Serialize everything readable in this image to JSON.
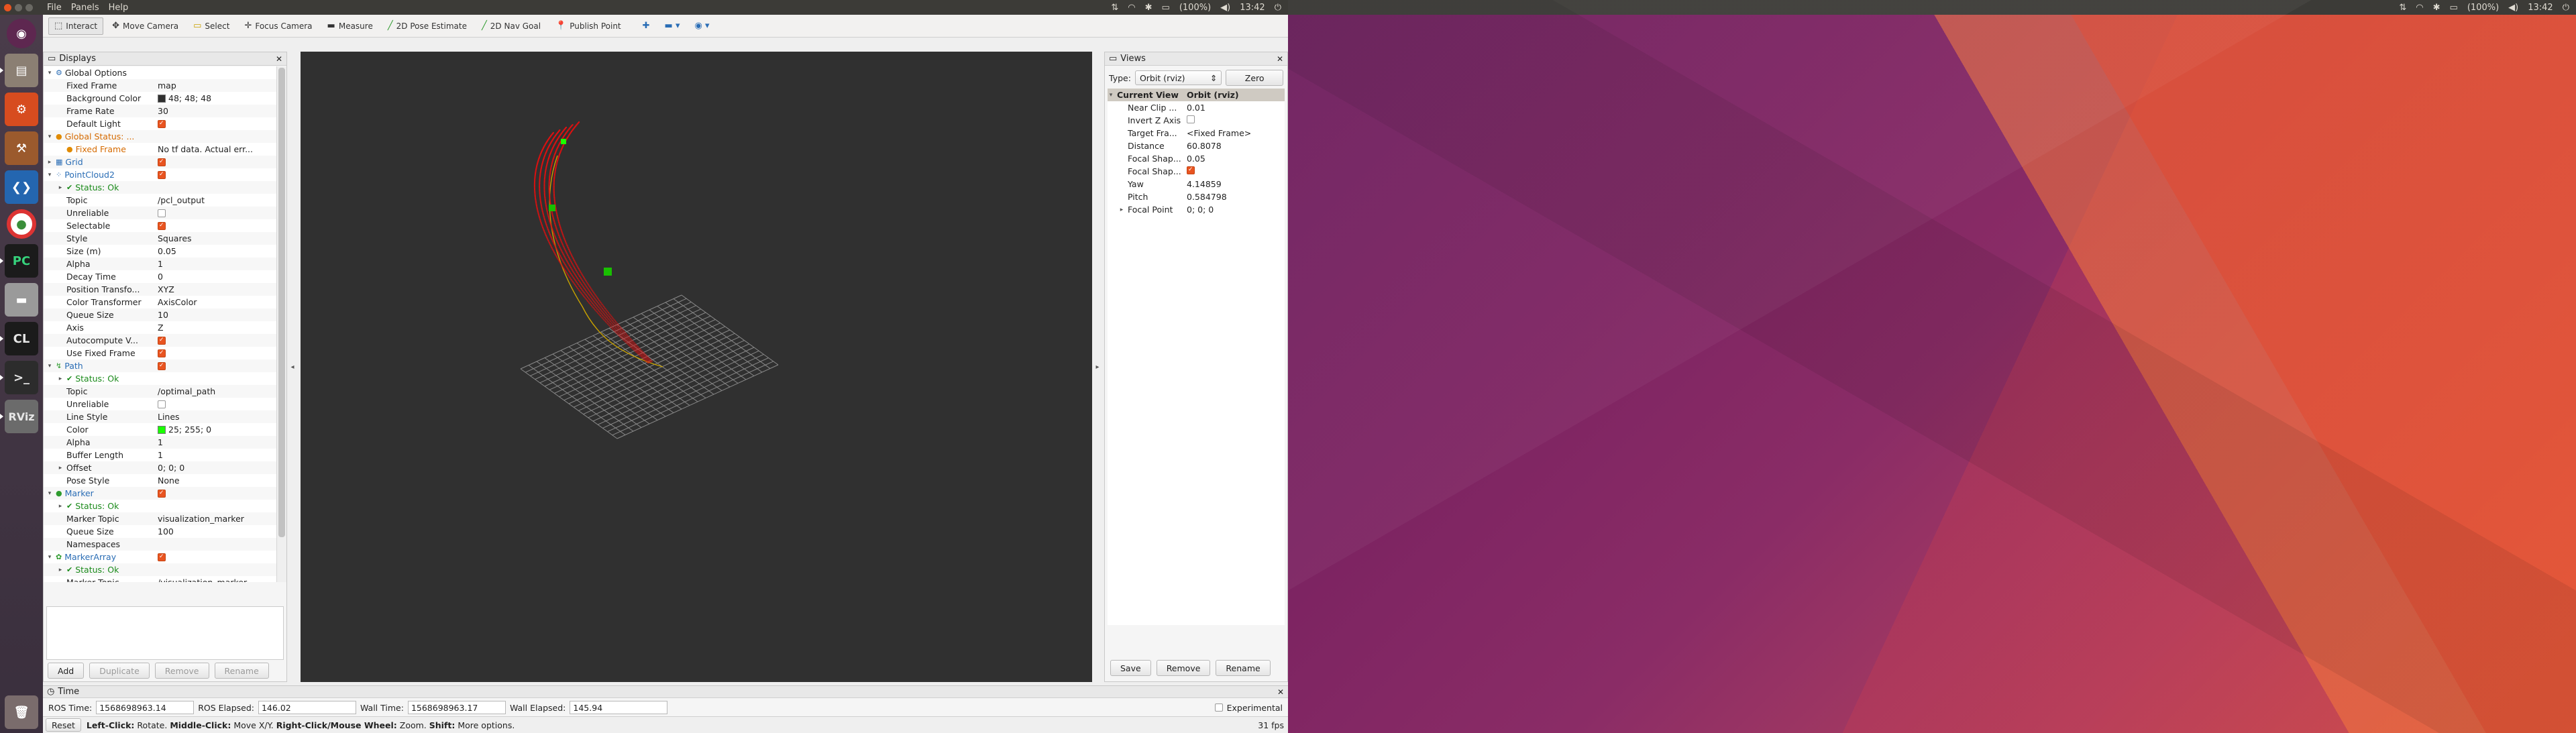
{
  "system_bar": {
    "menus": [
      "File",
      "Panels",
      "Help"
    ],
    "battery": "(100%)",
    "time": "13:42"
  },
  "toolbar": {
    "tools": [
      {
        "label": "Interact",
        "icon": "interact-icon"
      },
      {
        "label": "Move Camera",
        "icon": "move-camera-icon"
      },
      {
        "label": "Select",
        "icon": "select-icon"
      },
      {
        "label": "Focus Camera",
        "icon": "focus-camera-icon"
      },
      {
        "label": "Measure",
        "icon": "measure-icon"
      },
      {
        "label": "2D Pose Estimate",
        "icon": "pose-estimate-icon"
      },
      {
        "label": "2D Nav Goal",
        "icon": "nav-goal-icon"
      },
      {
        "label": "Publish Point",
        "icon": "publish-point-icon"
      }
    ]
  },
  "displays": {
    "title": "Displays",
    "rows": [
      {
        "indent": 0,
        "arrow": "▾",
        "icon": "gear-icon",
        "label": "Global Options",
        "value": "",
        "style": ""
      },
      {
        "indent": 1,
        "arrow": "",
        "label": "Fixed Frame",
        "value": "map"
      },
      {
        "indent": 1,
        "arrow": "",
        "label": "Background Color",
        "value": "48; 48; 48",
        "swatch": "#303030"
      },
      {
        "indent": 1,
        "arrow": "",
        "label": "Frame Rate",
        "value": "30"
      },
      {
        "indent": 1,
        "arrow": "",
        "label": "Default Light",
        "checkbox": true
      },
      {
        "indent": 0,
        "arrow": "▾",
        "icon": "warning-icon",
        "label": "Global Status: ...",
        "value": "",
        "style": "orange"
      },
      {
        "indent": 1,
        "arrow": "",
        "icon": "warning-icon",
        "label": "Fixed Frame",
        "value": "No tf data.  Actual err...",
        "style": "orange"
      },
      {
        "indent": 0,
        "arrow": "▸",
        "icon": "grid-icon",
        "label": "Grid",
        "checkbox": true,
        "style": "blue"
      },
      {
        "indent": 0,
        "arrow": "▾",
        "icon": "pointcloud-icon",
        "label": "PointCloud2",
        "checkbox": true,
        "style": "blue"
      },
      {
        "indent": 1,
        "arrow": "▸",
        "icon": "check-icon",
        "label": "Status: Ok",
        "value": "",
        "style": "ok"
      },
      {
        "indent": 1,
        "arrow": "",
        "label": "Topic",
        "value": "/pcl_output"
      },
      {
        "indent": 1,
        "arrow": "",
        "label": "Unreliable",
        "checkbox": false
      },
      {
        "indent": 1,
        "arrow": "",
        "label": "Selectable",
        "checkbox": true
      },
      {
        "indent": 1,
        "arrow": "",
        "label": "Style",
        "value": "Squares"
      },
      {
        "indent": 1,
        "arrow": "",
        "label": "Size (m)",
        "value": "0.05"
      },
      {
        "indent": 1,
        "arrow": "",
        "label": "Alpha",
        "value": "1"
      },
      {
        "indent": 1,
        "arrow": "",
        "label": "Decay Time",
        "value": "0"
      },
      {
        "indent": 1,
        "arrow": "",
        "label": "Position Transfo...",
        "value": "XYZ"
      },
      {
        "indent": 1,
        "arrow": "",
        "label": "Color Transformer",
        "value": "AxisColor"
      },
      {
        "indent": 1,
        "arrow": "",
        "label": "Queue Size",
        "value": "10"
      },
      {
        "indent": 1,
        "arrow": "",
        "label": "Axis",
        "value": "Z"
      },
      {
        "indent": 1,
        "arrow": "",
        "label": "Autocompute V...",
        "checkbox": true
      },
      {
        "indent": 1,
        "arrow": "",
        "label": "Use Fixed Frame",
        "checkbox": true
      },
      {
        "indent": 0,
        "arrow": "▾",
        "icon": "path-icon",
        "label": "Path",
        "checkbox": true,
        "style": "blue"
      },
      {
        "indent": 1,
        "arrow": "▸",
        "icon": "check-icon",
        "label": "Status: Ok",
        "value": "",
        "style": "ok"
      },
      {
        "indent": 1,
        "arrow": "",
        "label": "Topic",
        "value": "/optimal_path"
      },
      {
        "indent": 1,
        "arrow": "",
        "label": "Unreliable",
        "checkbox": false
      },
      {
        "indent": 1,
        "arrow": "",
        "label": "Line Style",
        "value": "Lines"
      },
      {
        "indent": 1,
        "arrow": "",
        "label": "Color",
        "value": "25; 255; 0",
        "swatch": "#19ff00"
      },
      {
        "indent": 1,
        "arrow": "",
        "label": "Alpha",
        "value": "1"
      },
      {
        "indent": 1,
        "arrow": "",
        "label": "Buffer Length",
        "value": "1"
      },
      {
        "indent": 1,
        "arrow": "▸",
        "label": "Offset",
        "value": "0; 0; 0"
      },
      {
        "indent": 1,
        "arrow": "",
        "label": "Pose Style",
        "value": "None"
      },
      {
        "indent": 0,
        "arrow": "▾",
        "icon": "marker-icon",
        "label": "Marker",
        "checkbox": true,
        "style": "blue"
      },
      {
        "indent": 1,
        "arrow": "▸",
        "icon": "check-icon",
        "label": "Status: Ok",
        "value": "",
        "style": "ok"
      },
      {
        "indent": 1,
        "arrow": "",
        "label": "Marker Topic",
        "value": "visualization_marker"
      },
      {
        "indent": 1,
        "arrow": "",
        "label": "Queue Size",
        "value": "100"
      },
      {
        "indent": 1,
        "arrow": "",
        "label": "Namespaces",
        "value": ""
      },
      {
        "indent": 0,
        "arrow": "▾",
        "icon": "marker-array-icon",
        "label": "MarkerArray",
        "checkbox": true,
        "style": "blue"
      },
      {
        "indent": 1,
        "arrow": "▸",
        "icon": "check-icon",
        "label": "Status: Ok",
        "value": "",
        "style": "ok"
      },
      {
        "indent": 1,
        "arrow": "",
        "label": "Marker Topic",
        "value": "/visualization_marker..."
      }
    ],
    "buttons": {
      "add": "Add",
      "duplicate": "Duplicate",
      "remove": "Remove",
      "rename": "Rename"
    }
  },
  "views": {
    "title": "Views",
    "type_label": "Type:",
    "type_value": "Orbit (rviz)",
    "zero_button": "Zero",
    "header": {
      "key": "Current View",
      "value": "Orbit (rviz)"
    },
    "rows": [
      {
        "label": "Near Clip ...",
        "value": "0.01"
      },
      {
        "label": "Invert Z Axis",
        "checkbox": false
      },
      {
        "label": "Target Fra...",
        "value": "<Fixed Frame>"
      },
      {
        "label": "Distance",
        "value": "60.8078"
      },
      {
        "label": "Focal Shap...",
        "value": "0.05"
      },
      {
        "label": "Focal Shap...",
        "checkbox": true
      },
      {
        "label": "Yaw",
        "value": "4.14859"
      },
      {
        "label": "Pitch",
        "value": "0.584798"
      },
      {
        "label": "Focal Point",
        "value": "0; 0; 0",
        "arrow": "▸"
      }
    ],
    "buttons": {
      "save": "Save",
      "remove": "Remove",
      "rename": "Rename"
    }
  },
  "time_panel": {
    "title": "Time",
    "ros_time_label": "ROS Time:",
    "ros_time": "1568698963.14",
    "ros_elapsed_label": "ROS Elapsed:",
    "ros_elapsed": "146.02",
    "wall_time_label": "Wall Time:",
    "wall_time": "1568698963.17",
    "wall_elapsed_label": "Wall Elapsed:",
    "wall_elapsed": "145.94",
    "experimental_label": "Experimental"
  },
  "statusbar": {
    "reset": "Reset",
    "left_click": "Left-Click:",
    "left_click_desc": "Rotate.",
    "middle_click": "Middle-Click:",
    "middle_click_desc": "Move X/Y.",
    "right_click": "Right-Click/Mouse Wheel:",
    "right_click_desc": "Zoom.",
    "shift": "Shift:",
    "shift_desc": "More options.",
    "fps": "31 fps"
  },
  "colors": {
    "viewport_bg": "#303030",
    "cloud": "#e01010",
    "path": "#19ff00",
    "accent": "#e95420"
  }
}
